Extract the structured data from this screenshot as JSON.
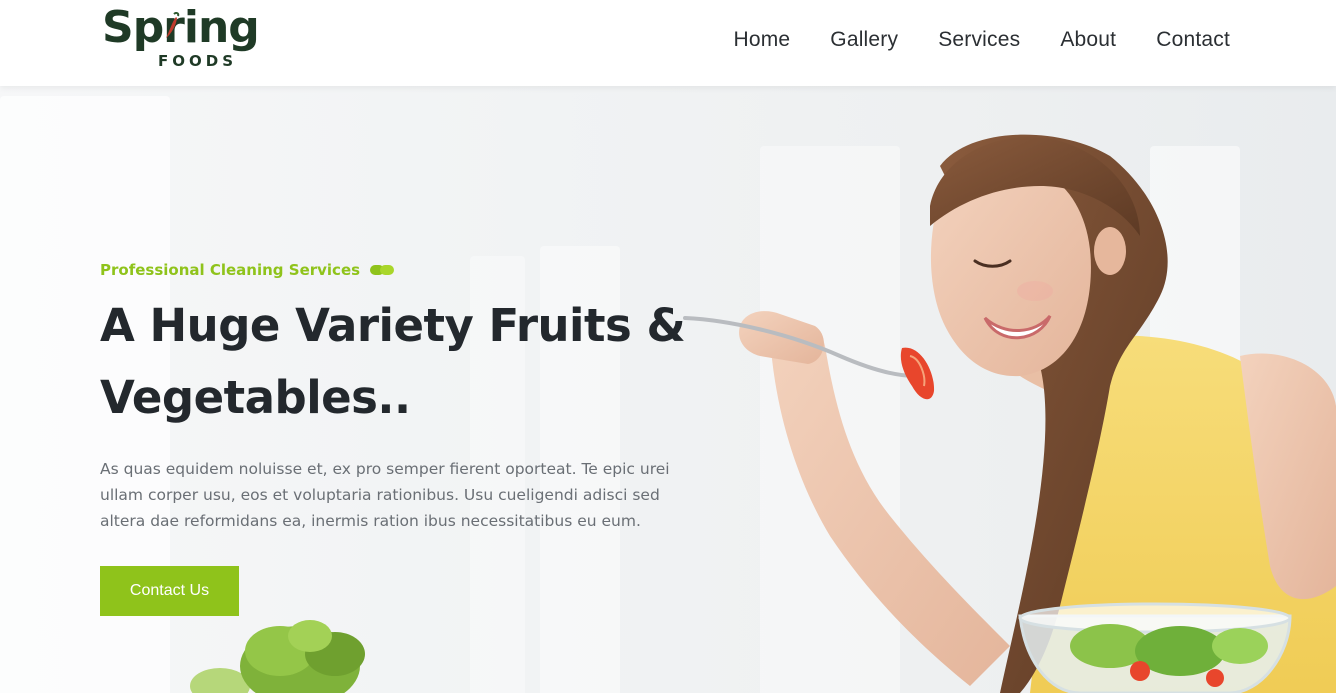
{
  "brand": {
    "logo_word": "Spring",
    "logo_sub": "FOODS"
  },
  "nav": {
    "items": [
      "Home",
      "Gallery",
      "Services",
      "About",
      "Contact"
    ]
  },
  "hero": {
    "tagline": "Professional Cleaning Services",
    "headline_line1": "A Huge Variety Fruits &",
    "headline_line2": "Vegetables..",
    "description": "As quas equidem noluisse et, ex pro semper fierent oporteat. Te epic urei ullam corper usu, eos et voluptaria rationibus. Usu cueligendi adisci sed altera dae reformidans ea, inermis ration ibus necessitatibus eu eum.",
    "cta_label": "Contact Us"
  },
  "colors": {
    "accent": "#8fc31b",
    "heading": "#23282d",
    "text": "#6a6f75",
    "logo": "#1f3a26"
  }
}
